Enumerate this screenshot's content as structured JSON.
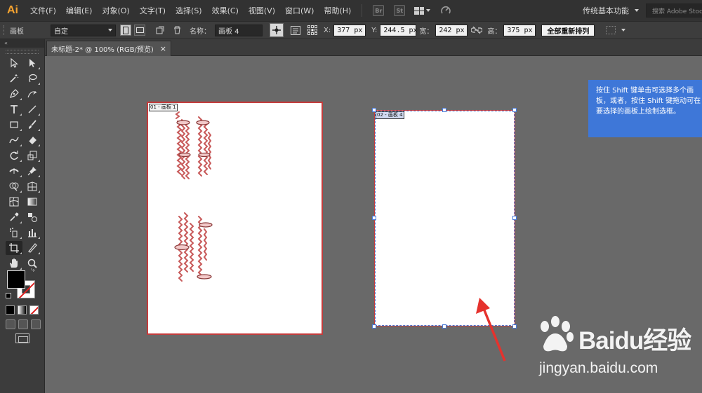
{
  "app": {
    "logo": "Ai",
    "menu": [
      "文件(F)",
      "编辑(E)",
      "对象(O)",
      "文字(T)",
      "选择(S)",
      "效果(C)",
      "视图(V)",
      "窗口(W)",
      "帮助(H)"
    ],
    "bridge_label": "Br",
    "stock_label": "St",
    "workspace": "传统基本功能",
    "search_placeholder": "搜索 Adobe Stock"
  },
  "control_bar": {
    "tool_label": "画板",
    "preset_value": "自定",
    "name_label": "名称：",
    "name_value": "画板 4",
    "x_label": "X:",
    "x_value": "377 px",
    "y_label": "Y:",
    "y_value": "244.5 px",
    "w_label": "宽：",
    "w_value": "242 px",
    "h_label": "高：",
    "h_value": "375 px",
    "rearrange_button": "全部重新排列"
  },
  "document_tab": {
    "title": "未标题-2* @ 100% (RGB/预览)",
    "close": "×"
  },
  "artboards": [
    {
      "label": "01 - 画板 1",
      "selected": false
    },
    {
      "label": "02 - 画板 4",
      "selected": true
    }
  ],
  "tooltip": "按住 Shift 键单击可选择多个画板，或者，按住 Shift 键拖动可在要选择的画板上绘制选框。",
  "watermark": {
    "brand": "Baidu经验",
    "url": "jingyan.baidu.com"
  },
  "colors": {
    "menubar": "#323232",
    "panel": "#3c3c3c",
    "canvas": "#696969",
    "artboard_border": "#c43c3c",
    "selection": "#4a7bd8",
    "tooltip_bg": "#3e77d8",
    "fill": "#000000",
    "stroke": "none"
  }
}
